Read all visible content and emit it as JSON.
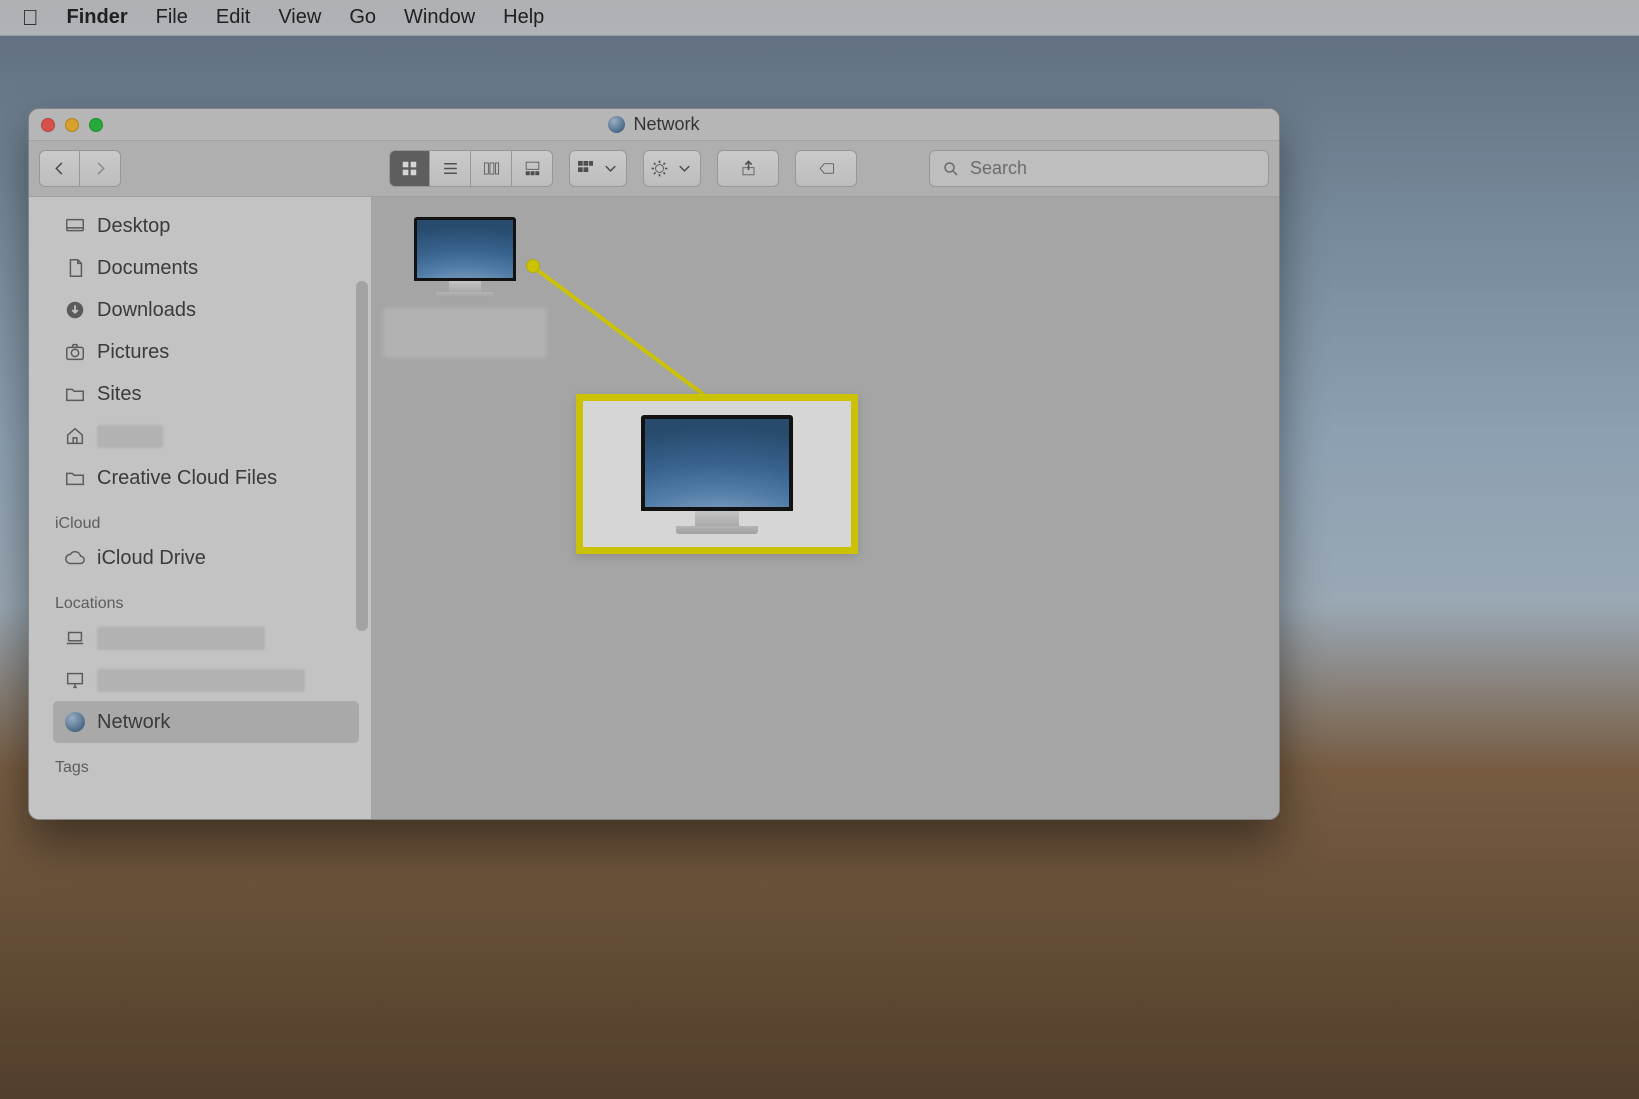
{
  "menubar": {
    "app": "Finder",
    "items": [
      "File",
      "Edit",
      "View",
      "Go",
      "Window",
      "Help"
    ]
  },
  "window": {
    "title": "Network"
  },
  "toolbar": {
    "search_placeholder": "Search"
  },
  "sidebar": {
    "favorites": [
      {
        "label": "Desktop",
        "icon": "desktop"
      },
      {
        "label": "Documents",
        "icon": "doc"
      },
      {
        "label": "Downloads",
        "icon": "download"
      },
      {
        "label": "Pictures",
        "icon": "camera"
      },
      {
        "label": "Sites",
        "icon": "folder"
      },
      {
        "label": "",
        "icon": "home",
        "blurred": true,
        "blur_w": 66
      },
      {
        "label": "Creative Cloud Files",
        "icon": "folder"
      }
    ],
    "section_icloud": "iCloud",
    "icloud": [
      {
        "label": "iCloud Drive",
        "icon": "cloud"
      }
    ],
    "section_locations": "Locations",
    "locations": [
      {
        "label": "",
        "icon": "laptop",
        "blurred": true,
        "blur_w": 168
      },
      {
        "label": "",
        "icon": "display",
        "blurred": true,
        "blur_w": 208
      },
      {
        "label": "Network",
        "icon": "globe",
        "selected": true
      }
    ],
    "section_tags": "Tags"
  },
  "content": {
    "net_item_label": "",
    "callout_label": ""
  }
}
